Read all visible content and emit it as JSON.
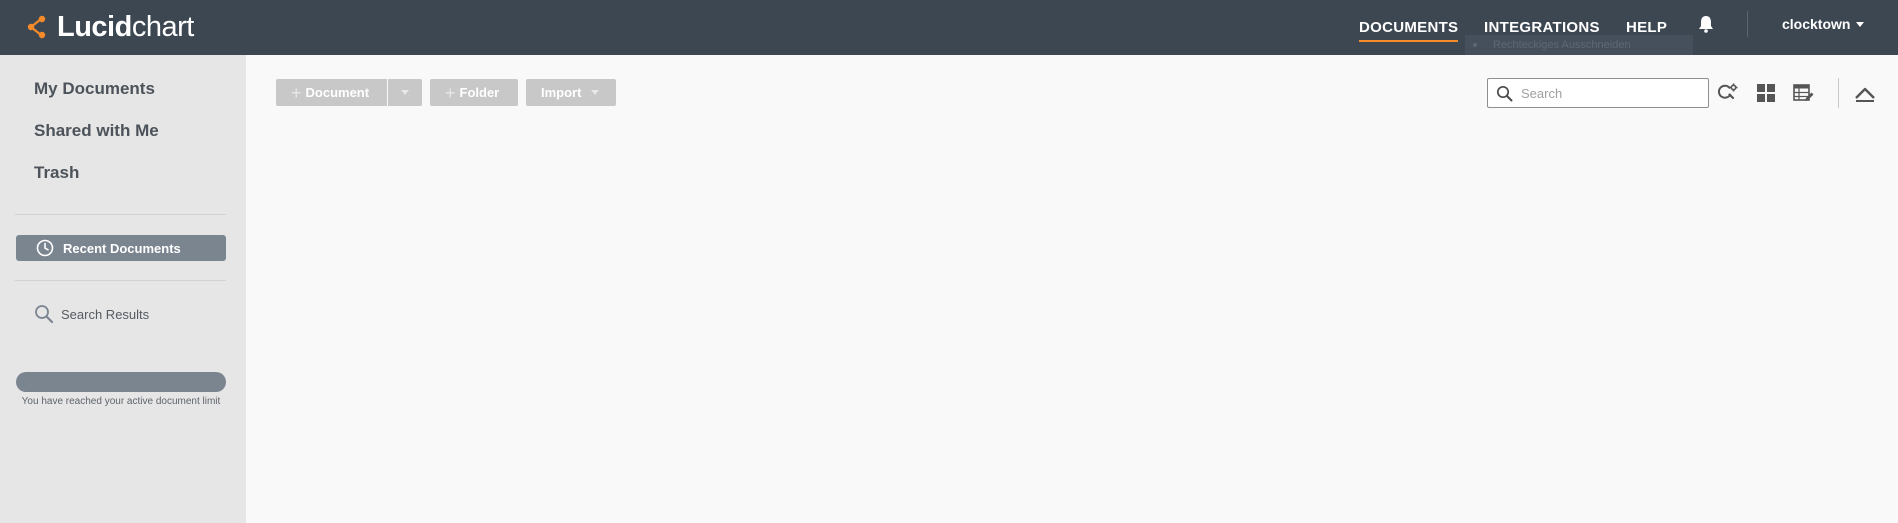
{
  "brand": {
    "name_bold": "Lucid",
    "name_light": "chart",
    "accent": "#f78b2a"
  },
  "header": {
    "nav": {
      "documents": "DOCUMENTS",
      "integrations": "INTEGRATIONS",
      "help": "HELP"
    },
    "username": "clocktown",
    "ghost_tooltip": "Rechteckiges Ausschneiden"
  },
  "sidebar": {
    "my_documents": "My Documents",
    "shared_with_me": "Shared with Me",
    "trash": "Trash",
    "recent_documents": "Recent Documents",
    "search_results": "Search Results",
    "limit_message": "You have reached your active document limit"
  },
  "toolbar": {
    "document_label": "Document",
    "folder_label": "Folder",
    "import_label": "Import",
    "search_placeholder": "Search"
  },
  "colors": {
    "topbar": "#3d4752",
    "sidebar": "#e6e6e6",
    "active_pill": "#7b8590",
    "disabled_button": "#c8c8c8"
  }
}
